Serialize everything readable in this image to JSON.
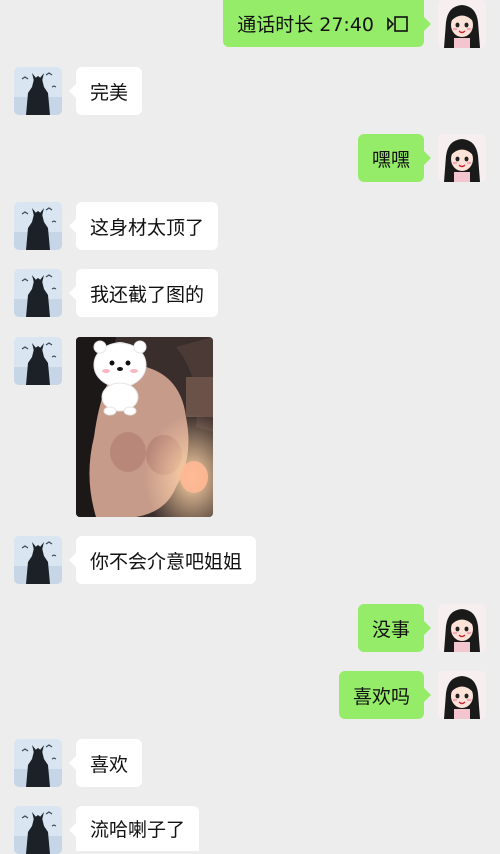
{
  "messages": [
    {
      "side": "right",
      "text": "通话时长 27:40",
      "icon": "video-call-icon"
    },
    {
      "side": "left",
      "text": "完美"
    },
    {
      "side": "right",
      "text": "嘿嘿"
    },
    {
      "side": "left",
      "text": "这身材太顶了"
    },
    {
      "side": "left",
      "text": "我还截了图的"
    },
    {
      "side": "left",
      "type": "image",
      "icon": "screenshot-photo"
    },
    {
      "side": "left",
      "text": "你不会介意吧姐姐"
    },
    {
      "side": "right",
      "text": "没事"
    },
    {
      "side": "right",
      "text": "喜欢吗"
    },
    {
      "side": "left",
      "text": "喜欢"
    },
    {
      "side": "left",
      "text": "流哈喇子了"
    }
  ],
  "colors": {
    "background": "#ededed",
    "sent_bubble": "#95ec69",
    "received_bubble": "#ffffff"
  }
}
